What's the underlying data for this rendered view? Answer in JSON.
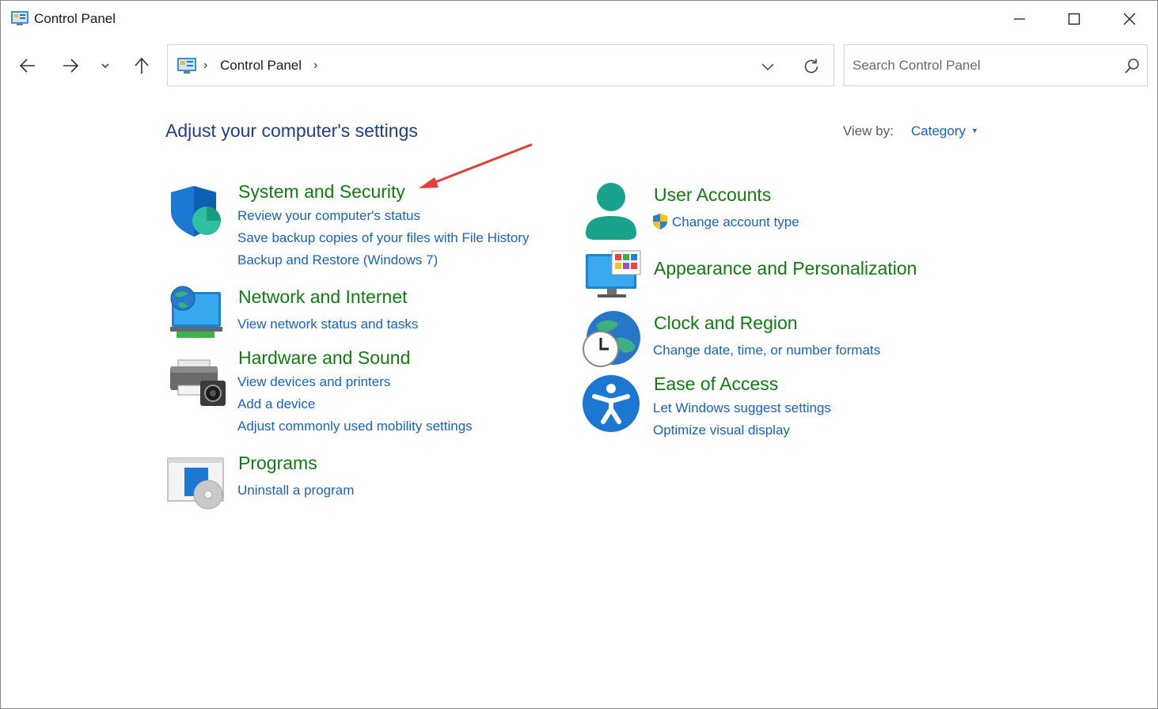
{
  "window": {
    "title": "Control Panel"
  },
  "address": {
    "crumb": "Control Panel"
  },
  "search": {
    "placeholder": "Search Control Panel"
  },
  "page": {
    "heading": "Adjust your computer's settings",
    "view_by_label": "View by:",
    "view_by_value": "Category"
  },
  "categories": {
    "system_security": {
      "title": "System and Security",
      "links": [
        "Review your computer's status",
        "Save backup copies of your files with File History",
        "Backup and Restore (Windows 7)"
      ]
    },
    "network": {
      "title": "Network and Internet",
      "links": [
        "View network status and tasks"
      ]
    },
    "hardware": {
      "title": "Hardware and Sound",
      "links": [
        "View devices and printers",
        "Add a device",
        "Adjust commonly used mobility settings"
      ]
    },
    "programs": {
      "title": "Programs",
      "links": [
        "Uninstall a program"
      ]
    },
    "user_accounts": {
      "title": "User Accounts",
      "links": [
        "Change account type"
      ]
    },
    "appearance": {
      "title": "Appearance and Personalization",
      "links": []
    },
    "clock": {
      "title": "Clock and Region",
      "links": [
        "Change date, time, or number formats"
      ]
    },
    "ease": {
      "title": "Ease of Access",
      "links": [
        "Let Windows suggest settings",
        "Optimize visual display"
      ]
    }
  },
  "colors": {
    "category_green": "#107c10",
    "link_blue": "#1a62c5",
    "heading_blue": "#1e3f8c",
    "annotation_red": "#e0403a"
  }
}
